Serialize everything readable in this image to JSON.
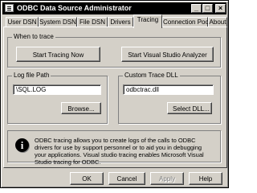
{
  "window": {
    "title": "ODBC Data Source Administrator",
    "buttons": {
      "minimize": "_",
      "maximize": "□",
      "close": "×"
    }
  },
  "tabs": [
    {
      "label": "User DSN",
      "active": false
    },
    {
      "label": "System DSN",
      "active": false
    },
    {
      "label": "File DSN",
      "active": false
    },
    {
      "label": "Drivers",
      "active": false
    },
    {
      "label": "Tracing",
      "active": true
    },
    {
      "label": "Connection Pooling",
      "active": false
    },
    {
      "label": "About",
      "active": false
    }
  ],
  "when_to_trace": {
    "label": "When to trace",
    "start_tracing_button": "Start Tracing Now",
    "start_vs_analyzer_button": "Start Visual Studio Analyzer"
  },
  "log_file_path": {
    "label": "Log file Path",
    "value": "\\SQL.LOG",
    "browse_button": "Browse..."
  },
  "custom_trace_dll": {
    "label": "Custom Trace DLL",
    "value": "odbctrac.dll",
    "select_button": "Select DLL..."
  },
  "info": {
    "icon": "info-icon",
    "text": "ODBC tracing allows you to create logs of the calls to ODBC drivers for use by support personnel or to aid you in debugging your applications. Visual studio tracing enables Microsoft Visual Studio tracing for ODBC."
  },
  "footer": {
    "ok": "OK",
    "cancel": "Cancel",
    "apply": "Apply",
    "help": "Help"
  }
}
